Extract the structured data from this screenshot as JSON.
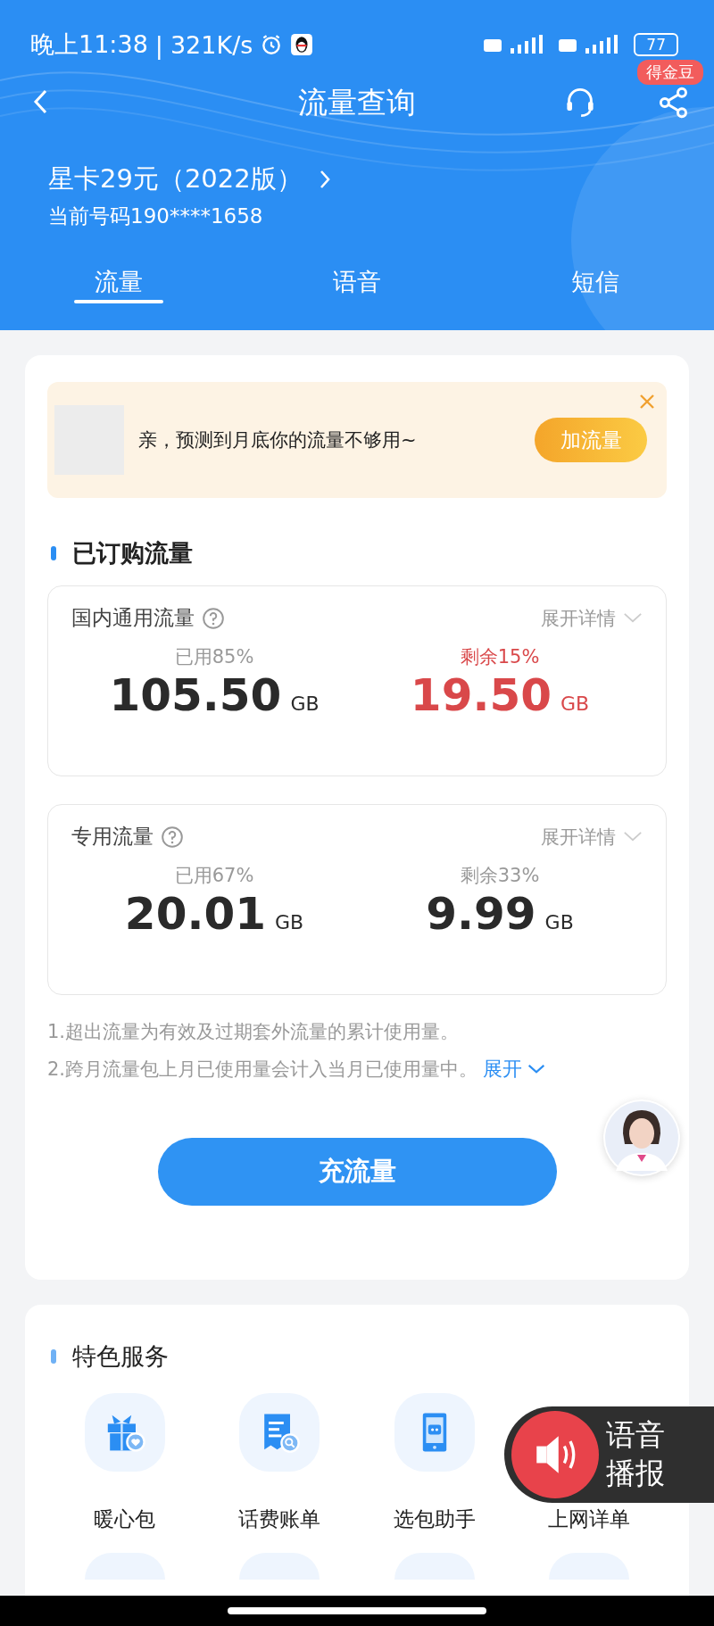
{
  "status_bar": {
    "time": "晚上11:38",
    "separator": "|",
    "speed": "321K/s",
    "battery": "77"
  },
  "header": {
    "title": "流量查询",
    "badge": "得金豆",
    "plan": "星卡29元（2022版）",
    "number": "当前号码190****1658"
  },
  "tabs": [
    {
      "label": "流量",
      "selected": true
    },
    {
      "label": "语音",
      "selected": false
    },
    {
      "label": "短信",
      "selected": false
    }
  ],
  "alert": {
    "message": "亲，预测到月底你的流量不够用~",
    "button": "加流量"
  },
  "subscribed": {
    "title": "已订购流量",
    "packages": [
      {
        "name": "国内通用流量",
        "details": "展开详情",
        "used_label": "已用85%",
        "used_value": "105.50",
        "used_unit": "GB",
        "remaining_label": "剩余15%",
        "remaining_value": "19.50",
        "remaining_unit": "GB",
        "warning": true
      },
      {
        "name": "专用流量",
        "details": "展开详情",
        "used_label": "已用67%",
        "used_value": "20.01",
        "used_unit": "GB",
        "remaining_label": "剩余33%",
        "remaining_value": "9.99",
        "remaining_unit": "GB",
        "warning": false
      }
    ],
    "notes": [
      "1.超出流量为有效及过期套外流量的累计使用量。",
      "2.跨月流量包上月已使用量会计入当月已使用量中。"
    ],
    "expand": "展开",
    "button": "充流量"
  },
  "services": {
    "title": "特色服务",
    "items": [
      {
        "label": "暖心包",
        "kind": "gift"
      },
      {
        "label": "话费账单",
        "kind": "bill"
      },
      {
        "label": "选包助手",
        "kind": "phone"
      },
      {
        "label": "上网详单",
        "kind": "hidden"
      }
    ]
  },
  "voice": {
    "label": "语音播报"
  }
}
